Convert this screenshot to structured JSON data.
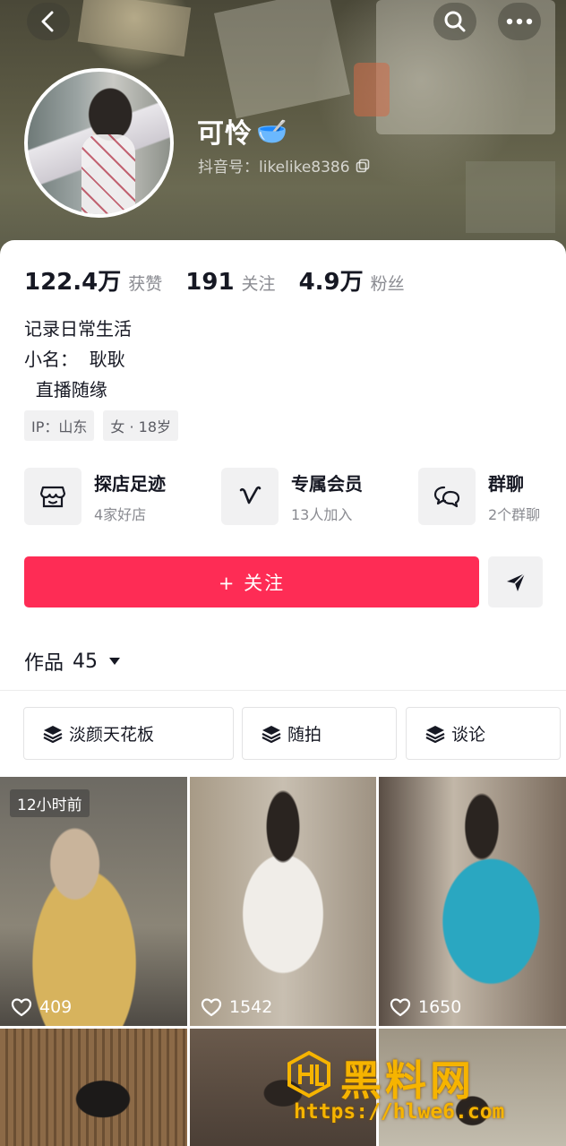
{
  "profile": {
    "nickname": "可怜",
    "nickname_emoji": "🥣",
    "douyin_id": "抖音号：likelike8386"
  },
  "stats": [
    {
      "value": "122.4万",
      "label": "获赞"
    },
    {
      "value": "191",
      "label": "关注"
    },
    {
      "value": "4.9万",
      "label": "粉丝"
    }
  ],
  "bio": [
    "记录日常生活",
    "小名：  耿耿",
    "  直播随缘"
  ],
  "tags": [
    "IP：山东",
    "女 · 18岁"
  ],
  "features": [
    {
      "title": "探店足迹",
      "subtitle": "4家好店",
      "icon": "store-icon"
    },
    {
      "title": "专属会员",
      "subtitle": "13人加入",
      "icon": "vip-v-icon"
    },
    {
      "title": "群聊",
      "subtitle": "2个群聊",
      "icon": "chat-bubbles-icon"
    }
  ],
  "follow_button": "+ 关注",
  "works": {
    "label": "作品",
    "count": "45"
  },
  "collections": [
    "淡颜天花板",
    "随拍",
    "谈论"
  ],
  "videos": [
    {
      "likes": "409",
      "badge": "12小时前"
    },
    {
      "likes": "1542"
    },
    {
      "likes": "1650"
    },
    {
      "likes": ""
    },
    {
      "likes": ""
    },
    {
      "likes": ""
    }
  ],
  "watermark": {
    "title": "黑料网",
    "url": "https://hlwe6.com"
  },
  "colors": {
    "accent": "#fe2c55",
    "text": "#161823",
    "secondary": "#8a8b91",
    "chip_bg": "#f1f1f2"
  }
}
